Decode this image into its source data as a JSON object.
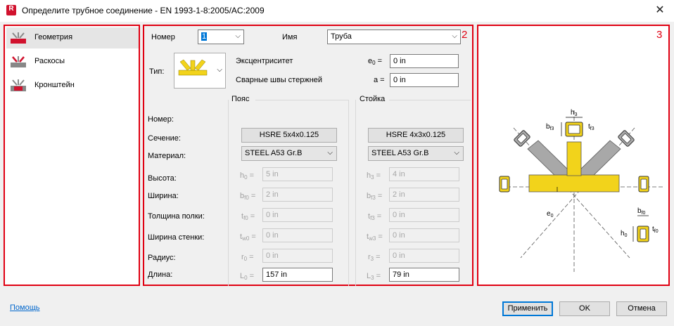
{
  "window": {
    "title": "Определите трубное соединение - EN 1993-1-8:2005/AC:2009",
    "app_icon_letter": "R",
    "close_glyph": "✕"
  },
  "sidebar": {
    "number": "1",
    "items": [
      {
        "label": "Геометрия",
        "active": true
      },
      {
        "label": "Раскосы",
        "active": false
      },
      {
        "label": "Кронштейн",
        "active": false
      }
    ]
  },
  "main": {
    "number": "2",
    "number_label": "Номер",
    "number_value": "1",
    "name_label": "Имя",
    "name_value": "Труба",
    "type_label": "Тип:",
    "eccentricity_label": "Эксцентриситет",
    "eccentricity_symbol": "e",
    "eccentricity_sub": "0",
    "eccentricity_value": "0 in",
    "welds_label": "Сварные швы стержней",
    "welds_symbol": "a =",
    "welds_value": "0 in",
    "chord_header": "Пояс",
    "post_header": "Стойка",
    "rows": {
      "number": "Номер:",
      "section": "Сечение:",
      "material": "Материал:",
      "height": "Высота:",
      "width": "Ширина:",
      "flange_thickness": "Толщина полки:",
      "web_width": "Ширина стенки:",
      "radius": "Радиус:",
      "length": "Длина:"
    },
    "chord": {
      "section": "HSRE 5x4x0.125",
      "material": "STEEL A53 Gr.B",
      "h": {
        "sym": "h",
        "sub": "0",
        "value": "5 in"
      },
      "b": {
        "sym": "b",
        "sub": "f0",
        "value": "2 in"
      },
      "t": {
        "sym": "t",
        "sub": "f0",
        "value": "0 in"
      },
      "tw": {
        "sym": "t",
        "sub": "w0",
        "value": "0 in"
      },
      "r": {
        "sym": "r",
        "sub": "0",
        "value": "0 in"
      },
      "L": {
        "sym": "L",
        "sub": "0",
        "value": "157 in"
      }
    },
    "post": {
      "section": "HSRE 4x3x0.125",
      "material": "STEEL A53 Gr.B",
      "h": {
        "sym": "h",
        "sub": "3",
        "value": "4 in"
      },
      "b": {
        "sym": "b",
        "sub": "f3",
        "value": "2 in"
      },
      "t": {
        "sym": "t",
        "sub": "f3",
        "value": "0 in"
      },
      "tw": {
        "sym": "t",
        "sub": "w3",
        "value": "0 in"
      },
      "r": {
        "sym": "r",
        "sub": "3",
        "value": "0 in"
      },
      "L": {
        "sym": "L",
        "sub": "3",
        "value": "79 in"
      }
    }
  },
  "preview": {
    "number": "3",
    "labels": {
      "h3": "h",
      "h3_sub": "3",
      "bf3": "b",
      "bf3_sub": "f3",
      "tf3": "t",
      "tf3_sub": "f3",
      "e0": "e",
      "e0_sub": "0",
      "bf0": "b",
      "bf0_sub": "f0",
      "h0": "h",
      "h0_sub": "0",
      "tf0": "t",
      "tf0_sub": "f0"
    },
    "colors": {
      "member_yellow": "#f2d31b",
      "diagonal_gray": "#a8a8a8"
    }
  },
  "footer": {
    "help": "Помощь",
    "apply": "Применить",
    "ok": "OK",
    "cancel": "Отмена"
  },
  "colors": {
    "frame_red": "#e00012",
    "link_blue": "#0066cc",
    "accent_blue": "#0078d7"
  }
}
